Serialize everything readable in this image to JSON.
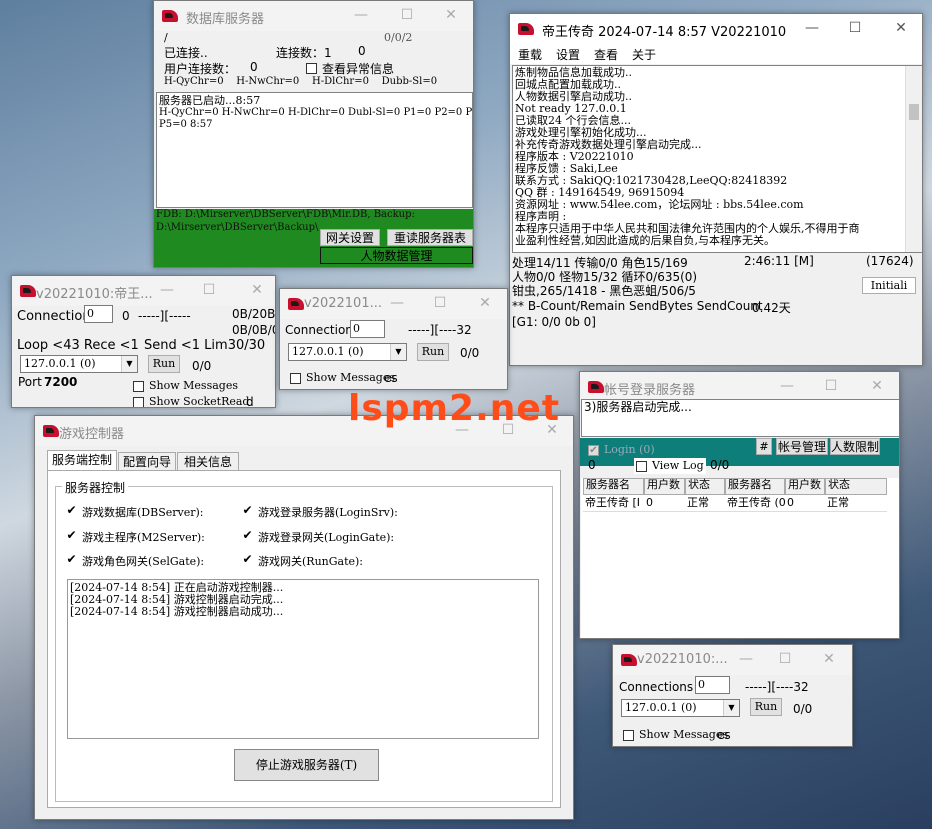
{
  "watermark": "lspm2.net",
  "db_server": {
    "title": "数据库服务器",
    "slash": "/",
    "ratio": "0/0/2",
    "connected_label": "已连接..",
    "conn_count_label": "连接数：1",
    "conn_count_value": "0",
    "user_conn_label": "用户连接数：",
    "user_conn_value": "0",
    "show_exceptions": "查看异常信息",
    "stats_line": "H-QyChr=0    H-NwChr=0    H-DlChr=0    Dubb-Sl=0",
    "log": [
      "服务器已启动...8:57",
      "H-QyChr=0 H-NwChr=0 H-DlChr=0 Dubl-Sl=0 P1=0 P2=0 P3=0 P4=0",
      "P5=0 8:57"
    ],
    "paths": [
      "FDB: D:\\Mirserver\\DBServer\\FDB\\Mir.DB, Backup:",
      "D:\\Mirserver\\DBServer\\Backup\\"
    ],
    "gateway_btn": "网关设置",
    "reload_btn": "重读服务器表",
    "char_mgmt_btn": "人物数据管理"
  },
  "main_server": {
    "title": "帝王传奇 2024-07-14 8:57 V20221010",
    "menu": [
      "重载",
      "设置",
      "查看",
      "关于"
    ],
    "log": [
      "炼制物品信息加载成功..",
      "回城点配置加载成功..",
      "人物数据引擎启动成功..",
      "Not ready 127.0.0.1",
      "已读取24 个行会信息...",
      "游戏处理引擎初始化成功...",
      "补充传奇游戏数据处理引擎启动完成...",
      "程序版本 : V20221010",
      "程序反馈 : Saki,Lee",
      "联系方式 : SakiQQ:1021730428,LeeQQ:82418392",
      "QQ    群 : 149164549, 96915094",
      "资源网址 : www.54lee.com，论坛网址 : bbs.54lee.com",
      "程序声明 :",
      "本程序只适用于中华人民共和国法律允许范围内的个人娱乐,不得用于商",
      "业盈利性经营,如因此造成的后果自负,与本程序无关。"
    ],
    "status1": "处理14/11 传输0/0 角色15/169",
    "time": "2:46:11 [M]",
    "counter": "(17624)",
    "status2": "人物0/0 怪物15/32 循环0/635(0)",
    "status3": "钳虫,265/1418 - 黑色恶蛆/506/5",
    "initial_btn": "Initiali",
    "status4": "** B-Count/Remain SendBytes SendCount",
    "days": "0.42天",
    "status5": "[G1: 0/0 0b 0]"
  },
  "gate1": {
    "title": "v20221010:帝王...",
    "conn_label": "Connection",
    "conn_value": "0",
    "conn_num": "0",
    "dashes": "-----][-----",
    "b1": "0B/20B",
    "b2": "0B/0B/0",
    "loop": "Loop <43  Rece <1",
    "send": "Send <1 Lim30/30",
    "ip": "127.0.0.1 (0)",
    "run": "Run",
    "zero": "0/0",
    "port_label": "Port",
    "port_value": "7200",
    "show_msgs": "Show Messages",
    "show_sock": "Show SocketRead",
    "tail": "d"
  },
  "gate2": {
    "title": "v2022101...",
    "conn_label": "Connection",
    "conn_value": "0",
    "dashes": "-----][----32",
    "ip": "127.0.0.1 (0)",
    "run": "Run",
    "zero": "0/0",
    "show_msgs": "Show Messages",
    "tail": "es"
  },
  "gate3": {
    "title": "v20221010:...",
    "conn_label": "Connections",
    "conn_value": "0",
    "dashes": "-----][----32",
    "ip": "127.0.0.1 (0)",
    "run": "Run",
    "zero": "0/0",
    "show_msgs": "Show Messages",
    "tail": "es"
  },
  "control": {
    "title": "游戏控制器",
    "tabs": [
      "服务端控制",
      "配置向导",
      "相关信息"
    ],
    "group": "服务器控制",
    "items": [
      "游戏数据库(DBServer):",
      "游戏主程序(M2Server):",
      "游戏角色网关(SelGate):",
      "游戏登录服务器(LoginSrv):",
      "游戏登录网关(LoginGate):",
      "游戏网关(RunGate):"
    ],
    "log": [
      "[2024-07-14 8:54] 正在启动游戏控制器...",
      "[2024-07-14 8:54] 游戏控制器启动完成...",
      "[2024-07-14 8:54] 游戏控制器启动成功..."
    ],
    "stop_btn": "停止游戏服务器(T)"
  },
  "login": {
    "title": "帐号登录服务器",
    "log": "3)服务器启动完成...",
    "login_chk": "Login (0)",
    "hash": "#",
    "acct_btn": "帐号管理",
    "limit_btn": "人数限制",
    "zero": "0",
    "view_log": "View Log",
    "ratio": "0/0",
    "headers": [
      "服务器名",
      "用户数",
      "状态",
      "服务器名",
      "用户数",
      "状态"
    ],
    "row": [
      "帝王传奇 [I",
      "0",
      "正常",
      "帝王传奇 (0",
      "0",
      "正常"
    ]
  },
  "colors": {
    "accent": "#c8102e",
    "green_panel": "#1f8a1f",
    "teal_panel": "#0e7e7a",
    "watermark": "#ff4d1a"
  }
}
